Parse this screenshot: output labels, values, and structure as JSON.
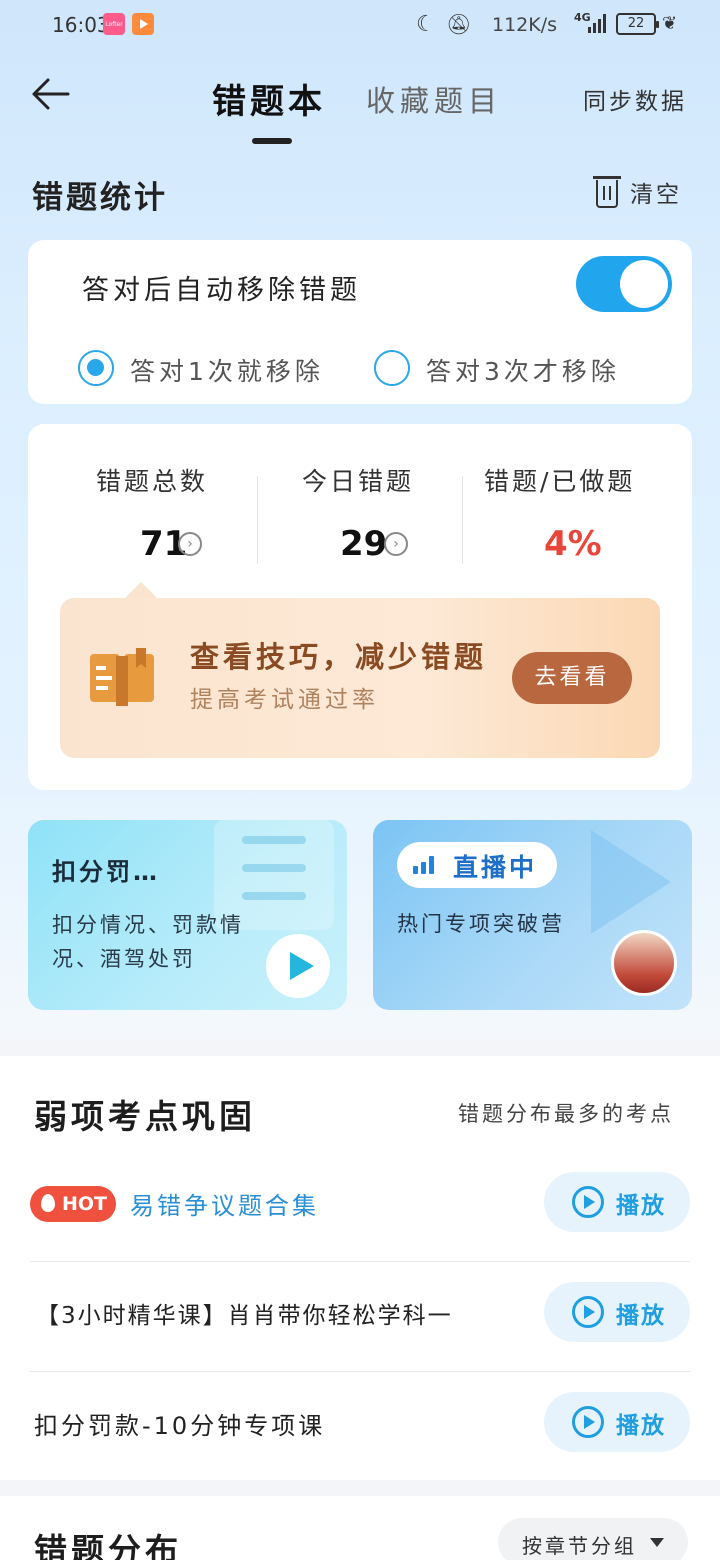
{
  "status_bar": {
    "time": "16:03",
    "app1_label": "Lofter",
    "net_speed": "112K/s",
    "network": "4G",
    "battery": "22",
    "icons": [
      "moon-icon",
      "bell-off-icon",
      "signal-icon",
      "battery-icon",
      "leaf-icon"
    ]
  },
  "header": {
    "back_icon": "back-arrow-icon",
    "tab_active": "错题本",
    "tab_other": "收藏题目",
    "sync": "同步数据"
  },
  "stats_section": {
    "title": "错题统计",
    "clear": "清空",
    "clear_icon": "trash-icon"
  },
  "auto_remove": {
    "label": "答对后自动移除错题",
    "toggle_on": true,
    "option1": "答对1次就移除",
    "option2": "答对3次才移除",
    "selected": "option1"
  },
  "stats": {
    "total_label": "错题总数",
    "total_value": "71",
    "today_label": "今日错题",
    "today_value": "29",
    "ratio_label": "错题/已做题",
    "ratio_value": "4%"
  },
  "tip": {
    "title": "查看技巧，减少错题",
    "subtitle": "提高考试通过率",
    "button": "去看看",
    "icon": "book-icon"
  },
  "mini_cards": {
    "left_title": "扣分罚…",
    "left_sub": "扣分情况、罚款情况、酒驾处罚",
    "right_live": "直播中",
    "right_sub": "热门专项突破营"
  },
  "weak_section": {
    "title": "弱项考点巩固",
    "right_text": "错题分布最多的考点",
    "hot_badge": "HOT",
    "play_label": "播放",
    "items": [
      {
        "title": "易错争议题合集",
        "hot": true
      },
      {
        "title": "【3小时精华课】肖肖带你轻松学科一",
        "hot": false
      },
      {
        "title": "扣分罚款-10分钟专项课",
        "hot": false
      }
    ]
  },
  "distribution": {
    "title": "错题分布",
    "group_button": "按章节分组"
  },
  "colors": {
    "accent": "#21a6ee",
    "hot_red": "#f0503e",
    "ratio_red": "#e8463a",
    "tip_button": "#b8673f"
  }
}
